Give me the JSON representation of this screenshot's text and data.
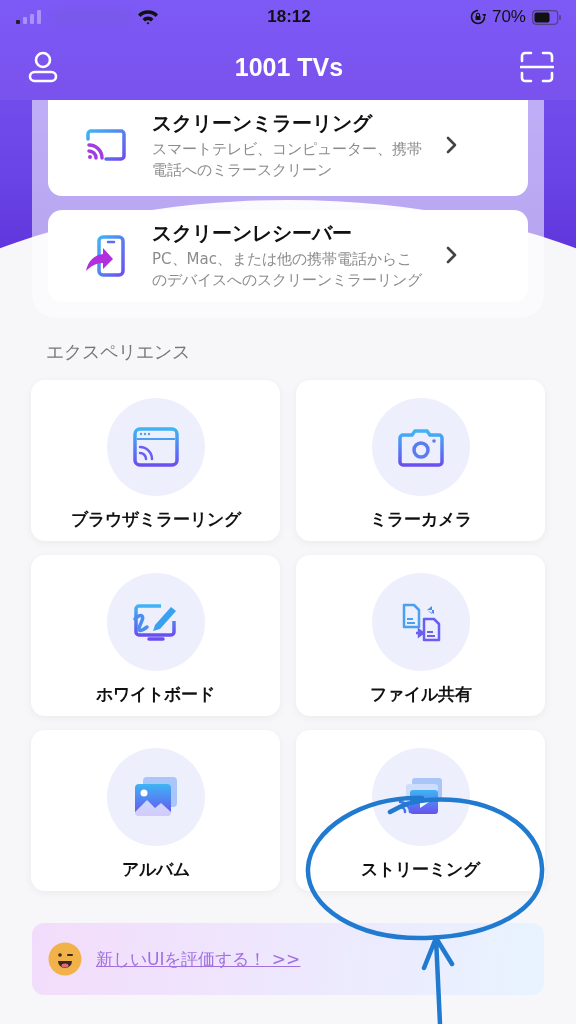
{
  "status_bar": {
    "time": "18:12",
    "battery": "70%"
  },
  "header": {
    "title": "1001 TVs"
  },
  "main_cards": [
    {
      "kind": "mirroring",
      "title": "スクリーンミラーリング",
      "description": "スマートテレビ、コンピューター、携帯電話へのミラースクリーン"
    },
    {
      "kind": "receiver",
      "title": "スクリーンレシーバー",
      "description": "PC、Mac、または他の携帯電話からこのデバイスへのスクリーンミラーリング"
    }
  ],
  "section_title": "エクスペリエンス",
  "features": [
    {
      "kind": "browser",
      "label": "ブラウザミラーリング"
    },
    {
      "kind": "camera",
      "label": "ミラーカメラ"
    },
    {
      "kind": "whiteboard",
      "label": "ホワイトボード"
    },
    {
      "kind": "files",
      "label": "ファイル共有"
    },
    {
      "kind": "album",
      "label": "アルバム"
    },
    {
      "kind": "streaming",
      "label": "ストリーミング"
    }
  ],
  "banner": {
    "link": "新しいUIを評価する！ >>"
  },
  "annotation": {
    "kind": "circle-arrow"
  }
}
